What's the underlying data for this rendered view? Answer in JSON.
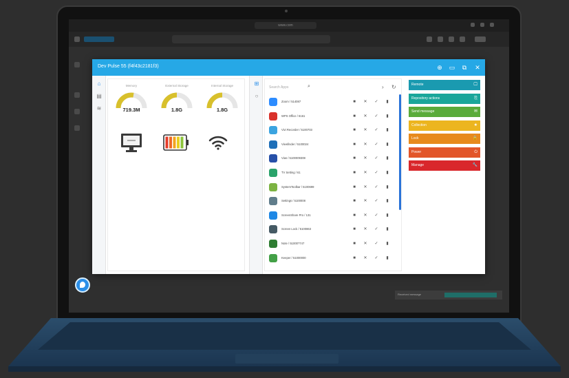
{
  "browser": {
    "url": "www.com"
  },
  "modal": {
    "title": "Dev Pulse 55 (f4f43c2181f3)",
    "stats": [
      {
        "label": "Memory",
        "value": "719.3M",
        "fill": 0.55,
        "color": "#d8c02c"
      },
      {
        "label": "External Storage",
        "value": "1.8G",
        "fill": 0.5,
        "color": "#d8c02c"
      },
      {
        "label": "Internal Storage",
        "value": "1.8G",
        "fill": 0.5,
        "color": "#d8c02c"
      }
    ],
    "battery_level": 0.85,
    "apps_search_placeholder": "Search Apps",
    "apps": [
      {
        "name": "Zoom / 514087",
        "icon_color": "#2d8cff"
      },
      {
        "name": "WPS Office / 6161",
        "icon_color": "#d9312b"
      },
      {
        "name": "Vivi Recorder / 5100703",
        "icon_color": "#3ba4e0"
      },
      {
        "name": "Viewfinder / 5100024",
        "icon_color": "#1e6fb8"
      },
      {
        "name": "Vias / 5100009308",
        "icon_color": "#2750a8"
      },
      {
        "name": "TV Setting / 61",
        "icon_color": "#2aa36b"
      },
      {
        "name": "SystemToolbar / 5100699",
        "icon_color": "#7cb342"
      },
      {
        "name": "Settings / 5100008",
        "icon_color": "#607d8b"
      },
      {
        "name": "ScreenShare Pro / 131",
        "icon_color": "#1e88e5"
      },
      {
        "name": "Screen Lock / 5100863",
        "icon_color": "#455a64"
      },
      {
        "name": "Note / 51000?747",
        "icon_color": "#2e7d32"
      },
      {
        "name": "Keeper / 51000000",
        "icon_color": "#43a047"
      }
    ],
    "actions": [
      {
        "label": "Remote",
        "color": "#1a9ab0",
        "icon": "🖵"
      },
      {
        "label": "Repository actions",
        "color": "#1aa69a",
        "icon": "⎘"
      },
      {
        "label": "Send message",
        "color": "#5aab3a",
        "icon": "✉"
      },
      {
        "label": "Collection",
        "color": "#ecb51f",
        "icon": "★"
      },
      {
        "label": "Lock",
        "color": "#e78a1c",
        "icon": "🔒"
      },
      {
        "label": "Power",
        "color": "#e2562a",
        "icon": "⏻"
      },
      {
        "label": "Manage",
        "color": "#d9272c",
        "icon": "🔧"
      }
    ]
  },
  "toast": {
    "text": "Received message"
  }
}
